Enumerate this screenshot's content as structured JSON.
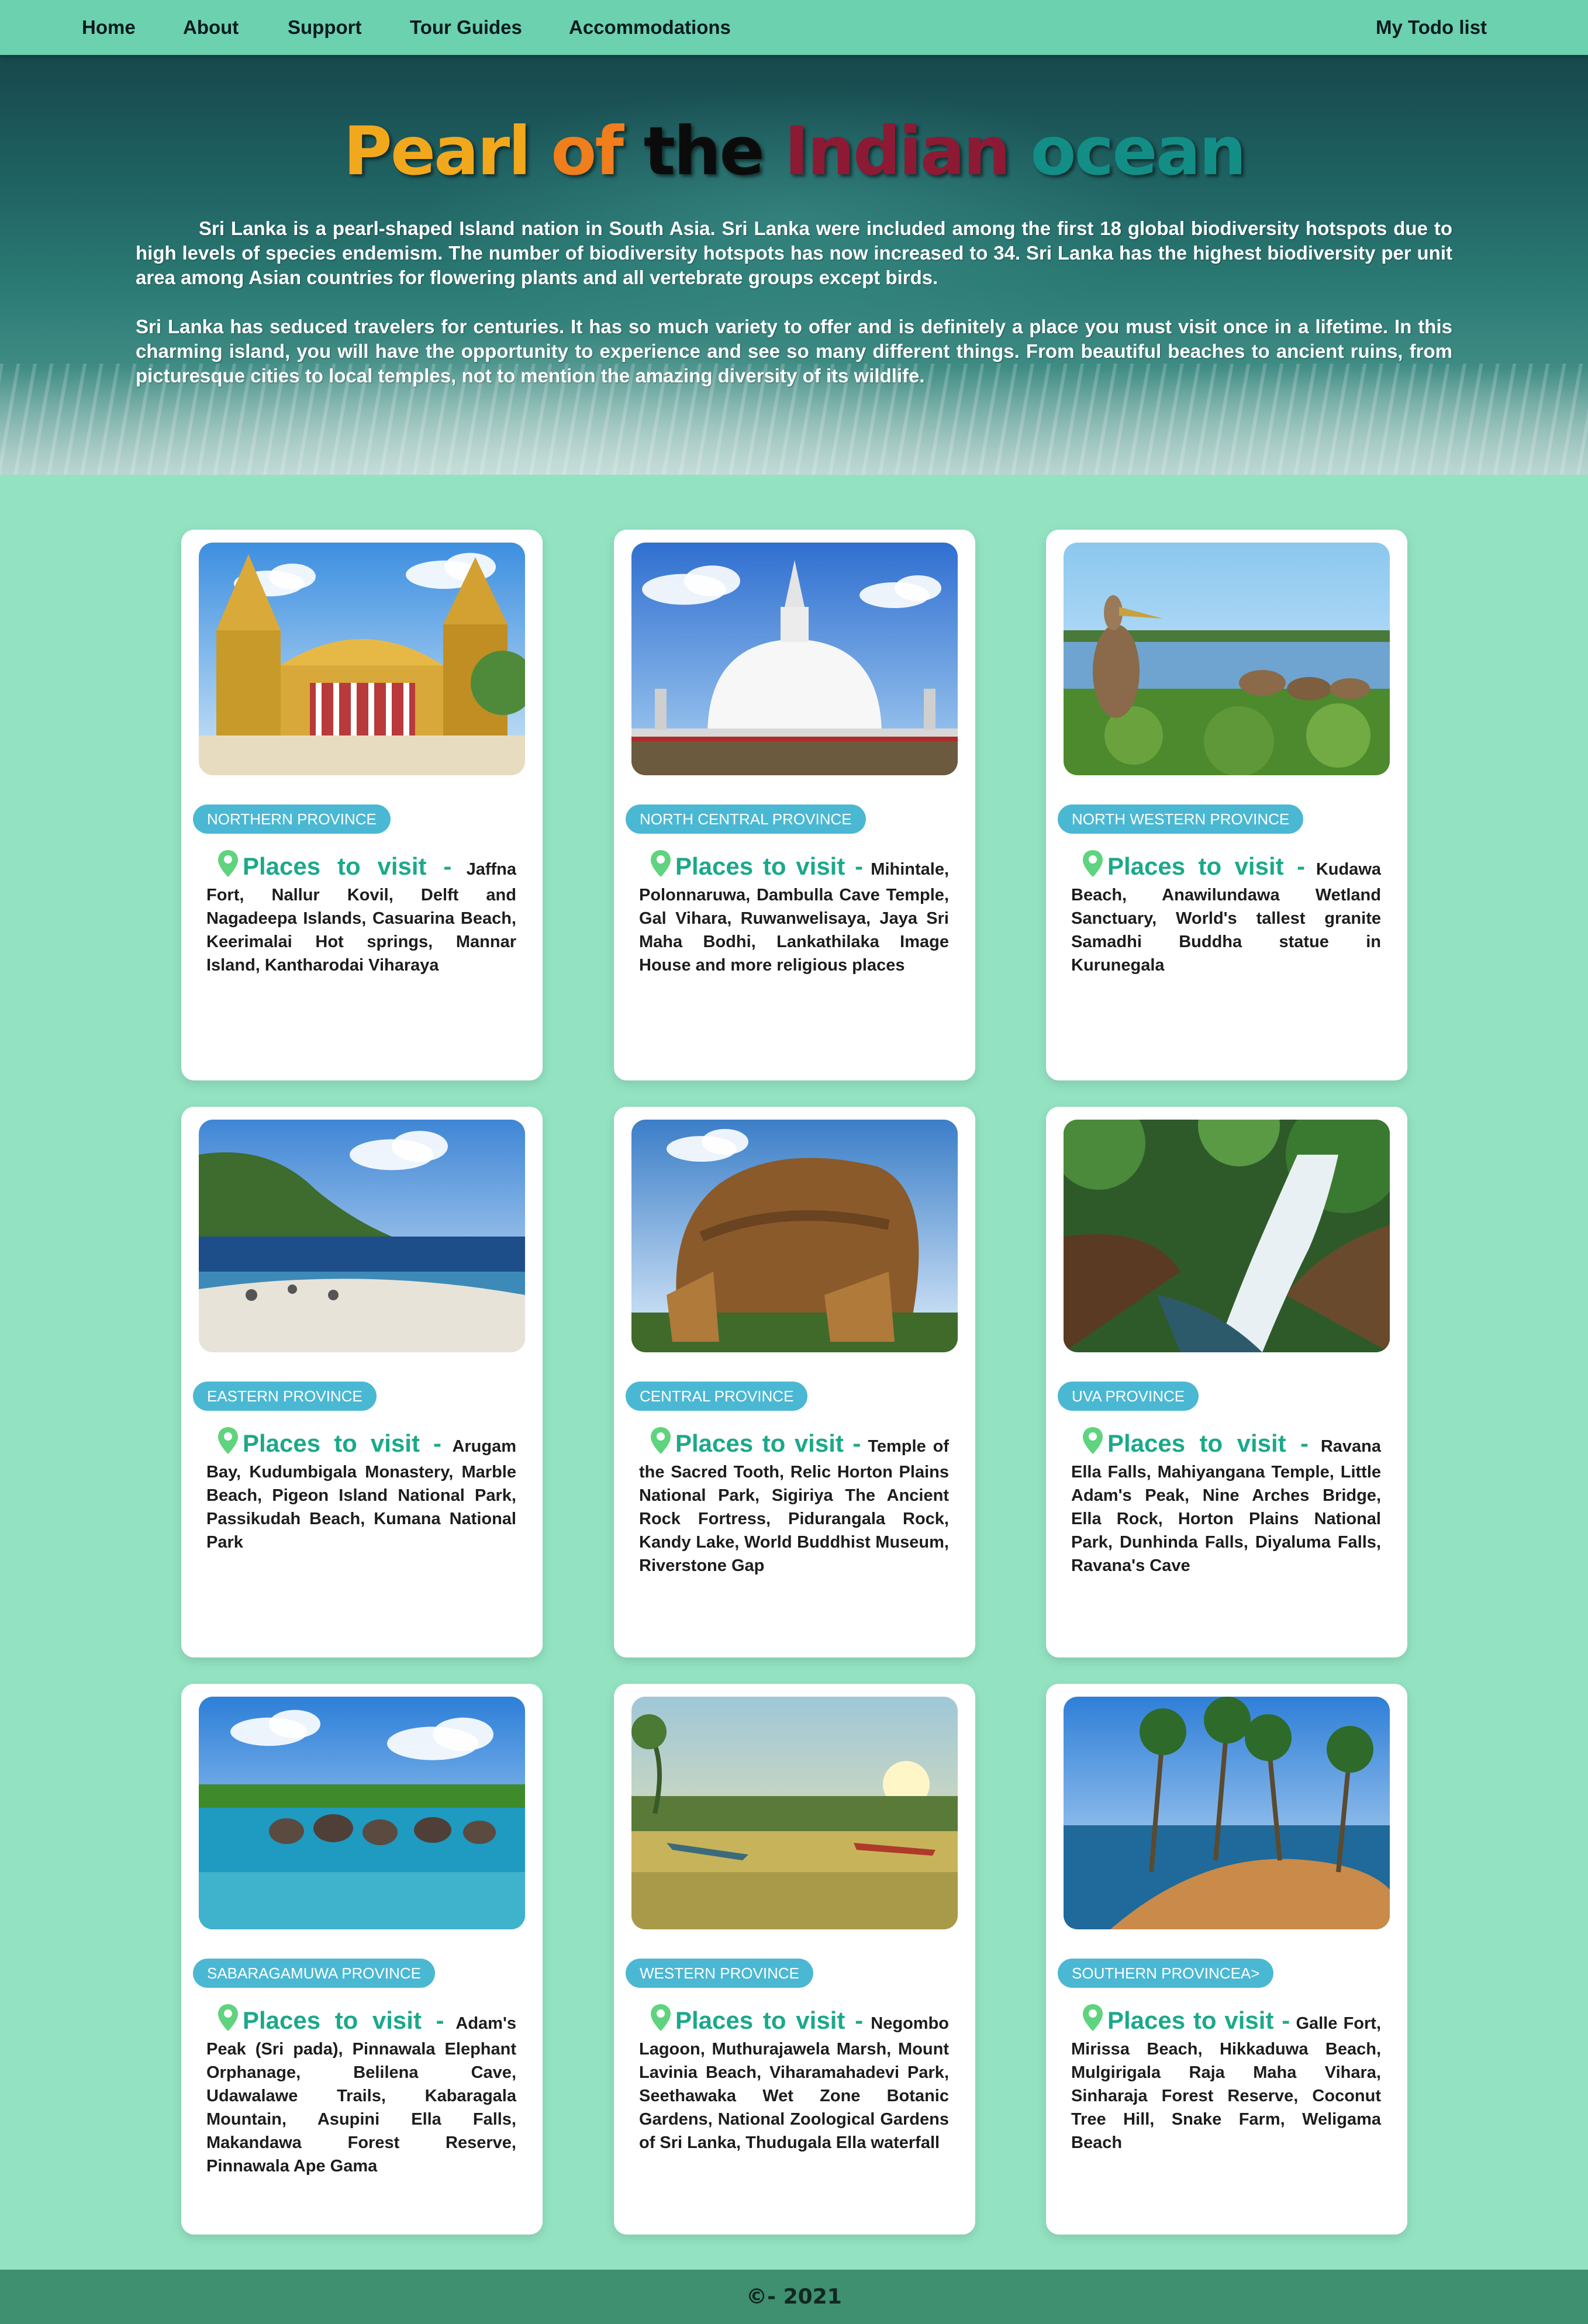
{
  "nav": {
    "items": [
      {
        "label": "Home"
      },
      {
        "label": "About"
      },
      {
        "label": "Support"
      },
      {
        "label": "Tour Guides"
      },
      {
        "label": "Accommodations"
      }
    ],
    "right_label": "My Todo list"
  },
  "hero": {
    "title_words": [
      {
        "text": "Pearl",
        "color": "#f2a81d"
      },
      {
        "text": "of",
        "color": "#f07e1c"
      },
      {
        "text": "the",
        "color": "#0b0b0b"
      },
      {
        "text": "Indian",
        "color": "#8c1a35"
      },
      {
        "text": "ocean",
        "color": "#138e86"
      }
    ],
    "paragraph1": "Sri Lanka is a pearl-shaped Island nation in South Asia. Sri Lanka were included among the first 18 global biodiversity hotspots due to high levels of species endemism. The number of biodiversity hotspots has now increased to 34. Sri Lanka has the highest biodiversity per unit area among Asian countries for flowering plants and all vertebrate groups except birds.",
    "paragraph2": "Sri Lanka has seduced travelers for centuries. It has so much variety to offer and is definitely a place you must visit once in a lifetime. In this charming island, you will have the opportunity to experience and see so many different things. From beautiful beaches to ancient ruins, from picturesque cities to local temples, not to mention the amazing diversity of its wildlife."
  },
  "places_label": "Places to visit -",
  "cards": [
    {
      "province": "NORTHERN PROVINCE",
      "image": "temple-kovil-image",
      "places": "Jaffna Fort, Nallur Kovil, Delft and Nagadeepa Islands, Casuarina Beach, Keerimalai Hot springs, Mannar Island, Kantharodai Viharaya"
    },
    {
      "province": "NORTH CENTRAL PROVINCE",
      "image": "stupa-image",
      "places": "Mihintale, Polonnaruwa, Dambulla Cave Temple, Gal Vihara, Ruwanwelisaya, Jaya Sri Maha Bodhi, Lankathilaka Image House and more religious places"
    },
    {
      "province": "NORTH WESTERN PROVINCE",
      "image": "wetland-birds-image",
      "places": "Kudawa Beach, Anawilundawa Wetland Sanctuary, World's tallest granite Samadhi Buddha statue in Kurunegala"
    },
    {
      "province": "EASTERN PROVINCE",
      "image": "beach-island-image",
      "places": "Arugam Bay, Kudumbigala Monastery, Marble Beach, Pigeon Island National Park, Passikudah Beach, Kumana National Park"
    },
    {
      "province": "CENTRAL PROVINCE",
      "image": "sigiriya-rock-image",
      "places": "Temple of the Sacred Tooth, Relic Horton Plains National Park, Sigiriya The Ancient Rock Fortress, Pidurangala Rock, Kandy Lake, World Buddhist Museum, Riverstone Gap"
    },
    {
      "province": "UVA PROVINCE",
      "image": "waterfall-image",
      "places": "Ravana Ella Falls, Mahiyangana Temple, Little Adam's Peak, Nine Arches Bridge, Ella Rock, Horton Plains National Park, Dunhinda Falls, Diyaluma Falls, Ravana's Cave"
    },
    {
      "province": "SABARAGAMUWA PROVINCE",
      "image": "elephants-river-image",
      "places": "Adam's Peak (Sri pada), Pinnawala Elephant Orphanage, Belilena Cave, Udawalawe Trails, Kabaragala Mountain, Asupini Ella Falls, Makandawa Forest Reserve, Pinnawala Ape Gama"
    },
    {
      "province": "WESTERN PROVINCE",
      "image": "lagoon-boats-image",
      "places": "Negombo Lagoon, Muthurajawela Marsh, Mount Lavinia Beach, Viharamahadevi Park, Seethawaka Wet Zone Botanic Gardens, National Zoological Gardens of Sri Lanka, Thudugala Ella waterfall"
    },
    {
      "province": "SOUTHERN PROVINCEA>",
      "image": "palm-hill-image",
      "places": "Galle Fort, Mirissa Beach, Hikkaduwa Beach, Mulgirigala Raja Maha Vihara, Sinharaja Forest Reserve, Coconut Tree Hill, Snake Farm, Weligama Beach"
    }
  ],
  "footer": {
    "text": "©- 2021"
  },
  "colors": {
    "page_bg": "#93e3c2",
    "nav_bg": "#6bd1ae",
    "badge_bg": "#4bb8d3",
    "places_label": "#1ba98a",
    "pin_icon": "#5fd37e",
    "footer_bg": "#3f8f71"
  }
}
